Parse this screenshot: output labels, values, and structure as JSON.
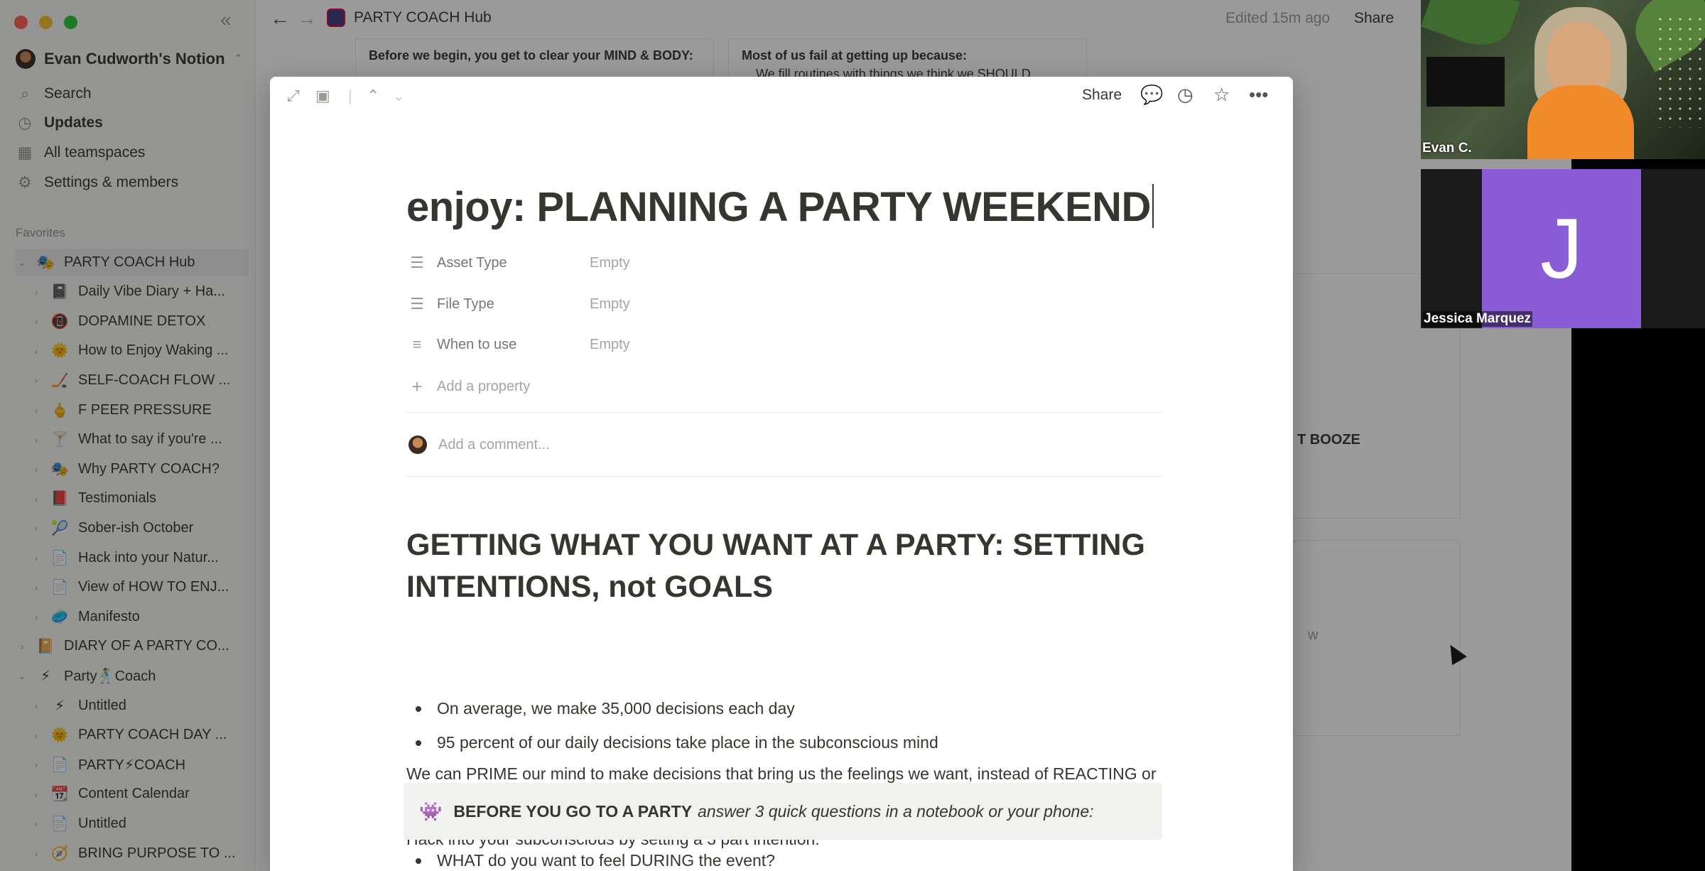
{
  "sidebar": {
    "workspace": "Evan Cudworth's Notion",
    "nav": [
      {
        "label": "Search",
        "icon": "search-icon"
      },
      {
        "label": "Updates",
        "icon": "clock-icon"
      },
      {
        "label": "All teamspaces",
        "icon": "building-icon"
      },
      {
        "label": "Settings & members",
        "icon": "gear-icon"
      }
    ],
    "favorites_label": "Favorites",
    "tree": [
      {
        "label": "PARTY COACH Hub",
        "emoji": "🎭",
        "level": 0
      },
      {
        "label": "Daily Vibe Diary + Ha...",
        "emoji": "📓",
        "level": 1
      },
      {
        "label": "DOPAMINE DETOX",
        "emoji": "📵",
        "level": 1
      },
      {
        "label": "How to Enjoy Waking ...",
        "emoji": "🌞",
        "level": 1
      },
      {
        "label": "SELF-COACH FLOW ...",
        "emoji": "🏒",
        "level": 1
      },
      {
        "label": "F PEER PRESSURE",
        "emoji": "🖕",
        "level": 1
      },
      {
        "label": "What to say if you're ...",
        "emoji": "🍸",
        "level": 1
      },
      {
        "label": "Why PARTY COACH?",
        "emoji": "🎭",
        "level": 1
      },
      {
        "label": "Testimonials",
        "emoji": "📕",
        "level": 1
      },
      {
        "label": "Sober-ish October",
        "emoji": "🎾",
        "level": 1
      },
      {
        "label": "Hack into your Natur...",
        "emoji": "📄",
        "level": 1
      },
      {
        "label": "View of HOW TO ENJ...",
        "emoji": "📄",
        "level": 1
      },
      {
        "label": "Manifesto",
        "emoji": "🥏",
        "level": 1
      },
      {
        "label": "DIARY OF A PARTY CO...",
        "emoji": "📔",
        "level": 0
      },
      {
        "label": "Party🕺Coach",
        "emoji": "⚡",
        "level": 0
      },
      {
        "label": "Untitled",
        "emoji": "⚡",
        "level": 1
      },
      {
        "label": "PARTY COACH DAY ...",
        "emoji": "🌞",
        "level": 1
      },
      {
        "label": "PARTY⚡COACH",
        "emoji": "📄",
        "level": 1
      },
      {
        "label": "Content Calendar",
        "emoji": "📆",
        "level": 1
      },
      {
        "label": "Untitled",
        "emoji": "📄",
        "level": 1
      },
      {
        "label": "BRING PURPOSE TO ...",
        "emoji": "🧭",
        "level": 1
      }
    ]
  },
  "topbar": {
    "page_title": "PARTY COACH Hub",
    "edited": "Edited 15m ago",
    "share": "Share"
  },
  "background": {
    "card1_title": "Before we begin, you get to clear your MIND & BODY:",
    "card2_title": "Most of us fail at getting up because:",
    "card2_item": "We fill routines with things we think we SHOULD",
    "side_text": "T BOOZE",
    "side_text2": "w"
  },
  "modal": {
    "share": "Share",
    "title": "enjoy: PLANNING A PARTY WEEKEND",
    "properties": [
      {
        "name": "Asset Type",
        "value": "Empty",
        "icon": "list-icon"
      },
      {
        "name": "File Type",
        "value": "Empty",
        "icon": "list-icon"
      },
      {
        "name": "When to use",
        "value": "Empty",
        "icon": "text-lines-icon"
      }
    ],
    "add_property": "Add a property",
    "comment_placeholder": "Add a comment...",
    "heading": "GETTING WHAT YOU WANT AT A PARTY: SETTING INTENTIONS, not GOALS",
    "bullets": [
      "On average, we make 35,000 decisions each day",
      "95 percent of our daily decisions take place in the subconscious mind"
    ],
    "para1": "We can PRIME our mind to make decisions that bring us the feelings we want, instead of REACTING or PANICKING in the moment.",
    "para2": "Hack into your subconscious by setting a 3 part intention:",
    "callout_bold": "BEFORE YOU GO TO A PARTY",
    "callout_italic": "answer 3 quick questions in a notebook or your phone:",
    "bullet3": "WHAT do you want to feel DURING the event?"
  },
  "video": {
    "participant1": "Evan C.",
    "participant2": "Jessica Marquez",
    "participant2_initial": "J"
  }
}
